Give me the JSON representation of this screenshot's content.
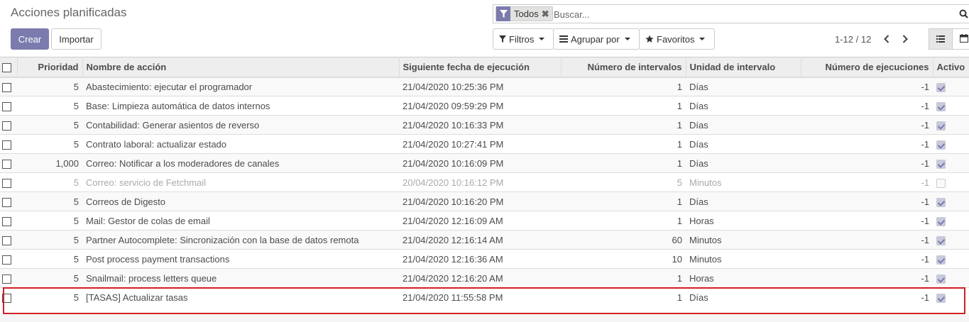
{
  "control_panel": {
    "title": "Acciones planificadas",
    "create_label": "Crear",
    "import_label": "Importar"
  },
  "search": {
    "facet_label": "Todos",
    "facet_icon": "filter-icon",
    "placeholder": "Buscar..."
  },
  "search_options": {
    "filters_label": "Filtros",
    "group_by_label": "Agrupar por",
    "favorites_label": "Favoritos"
  },
  "pager": {
    "value": "1-12 / 12"
  },
  "views": [
    "list",
    "calendar"
  ],
  "accent_color": "#7c7bad",
  "table": {
    "columns": {
      "priority": "Prioridad",
      "name": "Nombre de acción",
      "next_date": "Siguiente fecha de ejecución",
      "interval_number": "Número de intervalos",
      "interval_unit": "Unidad de intervalo",
      "numbercall": "Número de ejecuciones",
      "active": "Activo"
    },
    "rows": [
      {
        "priority": "5",
        "name": "Abastecimiento: ejecutar el programador",
        "next_date": "21/04/2020 10:25:36 PM",
        "interval_number": "1",
        "interval_unit": "Días",
        "numbercall": "-1",
        "active": true
      },
      {
        "priority": "5",
        "name": "Base: Limpieza automática de datos internos",
        "next_date": "21/04/2020 09:59:29 PM",
        "interval_number": "1",
        "interval_unit": "Días",
        "numbercall": "-1",
        "active": true
      },
      {
        "priority": "5",
        "name": "Contabilidad: Generar asientos de reverso",
        "next_date": "21/04/2020 10:16:33 PM",
        "interval_number": "1",
        "interval_unit": "Días",
        "numbercall": "-1",
        "active": true
      },
      {
        "priority": "5",
        "name": "Contrato laboral: actualizar estado",
        "next_date": "21/04/2020 10:27:41 PM",
        "interval_number": "1",
        "interval_unit": "Días",
        "numbercall": "-1",
        "active": true
      },
      {
        "priority": "1,000",
        "name": "Correo: Notificar a los moderadores de canales",
        "next_date": "21/04/2020 10:16:09 PM",
        "interval_number": "1",
        "interval_unit": "Días",
        "numbercall": "-1",
        "active": true
      },
      {
        "priority": "5",
        "name": "Correo: servicio de Fetchmail",
        "next_date": "20/04/2020 10:16:12 PM",
        "interval_number": "5",
        "interval_unit": "Minutos",
        "numbercall": "-1",
        "active": false
      },
      {
        "priority": "5",
        "name": "Correos de Digesto",
        "next_date": "21/04/2020 10:16:20 PM",
        "interval_number": "1",
        "interval_unit": "Días",
        "numbercall": "-1",
        "active": true
      },
      {
        "priority": "5",
        "name": "Mail: Gestor de colas de email",
        "next_date": "21/04/2020 12:16:09 AM",
        "interval_number": "1",
        "interval_unit": "Horas",
        "numbercall": "-1",
        "active": true
      },
      {
        "priority": "5",
        "name": "Partner Autocomplete: Sincronización con la base de datos remota",
        "next_date": "21/04/2020 12:16:14 AM",
        "interval_number": "60",
        "interval_unit": "Minutos",
        "numbercall": "-1",
        "active": true
      },
      {
        "priority": "5",
        "name": "Post process payment transactions",
        "next_date": "21/04/2020 12:16:36 AM",
        "interval_number": "10",
        "interval_unit": "Minutos",
        "numbercall": "-1",
        "active": true
      },
      {
        "priority": "5",
        "name": "Snailmail: process letters queue",
        "next_date": "21/04/2020 12:16:20 AM",
        "interval_number": "1",
        "interval_unit": "Horas",
        "numbercall": "-1",
        "active": true
      },
      {
        "priority": "5",
        "name": "[TASAS] Actualizar tasas",
        "next_date": "21/04/2020 11:55:58 PM",
        "interval_number": "1",
        "interval_unit": "Días",
        "numbercall": "-1",
        "active": true
      }
    ]
  },
  "highlight_color": "#d11f26"
}
